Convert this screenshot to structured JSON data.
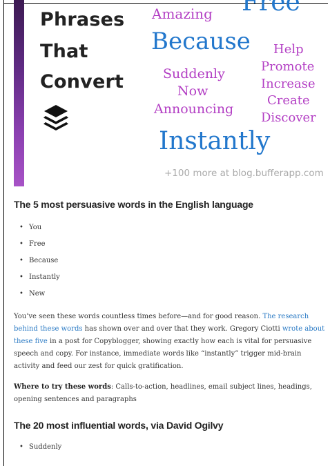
{
  "hero": {
    "title_lines": [
      "Phrases",
      "That",
      "Convert"
    ],
    "icon": "layers-icon",
    "bar_colors": [
      "#3c1a52",
      "#5e2a82",
      "#8a3fb0",
      "#a752c6"
    ],
    "words": {
      "amazing": "Amazing",
      "free": "Free",
      "because": "Because",
      "help": "Help",
      "suddenly": "Suddenly",
      "promote": "Promote",
      "now": "Now",
      "increase": "Increase",
      "announcing": "Announcing",
      "create": "Create",
      "discover": "Discover",
      "instantly": "Instantly"
    },
    "colors": {
      "purple": "#b33fc4",
      "blue": "#2277cc"
    },
    "more_text": "+100 more at blog.bufferapp.com"
  },
  "section1": {
    "heading": "The 5 most persuasive words in the English language",
    "items": [
      "You",
      "Free",
      "Because",
      "Instantly",
      "New"
    ],
    "para": {
      "t1": "You’ve seen these words countless times before—and for good reason. ",
      "link1": "The research behind these words",
      "t2": " has shown over and over that they work. Gregory Ciotti ",
      "link2": "wrote about these five",
      "t3": " in a post for Copyblogger, showing exactly how each is vital for persuasive speech and copy. For instance, immediate words like “instantly” trigger mid-brain activity and feed our zest for quick gratification."
    },
    "try_label": "Where to try these words",
    "try_text": ": Calls-to-action, headlines, email subject lines, headings, opening sentences and paragraphs"
  },
  "section2": {
    "heading": "The 20 most influential words, via David Ogilvy",
    "items": [
      "Suddenly"
    ]
  },
  "link_color": "#2a7ac4"
}
